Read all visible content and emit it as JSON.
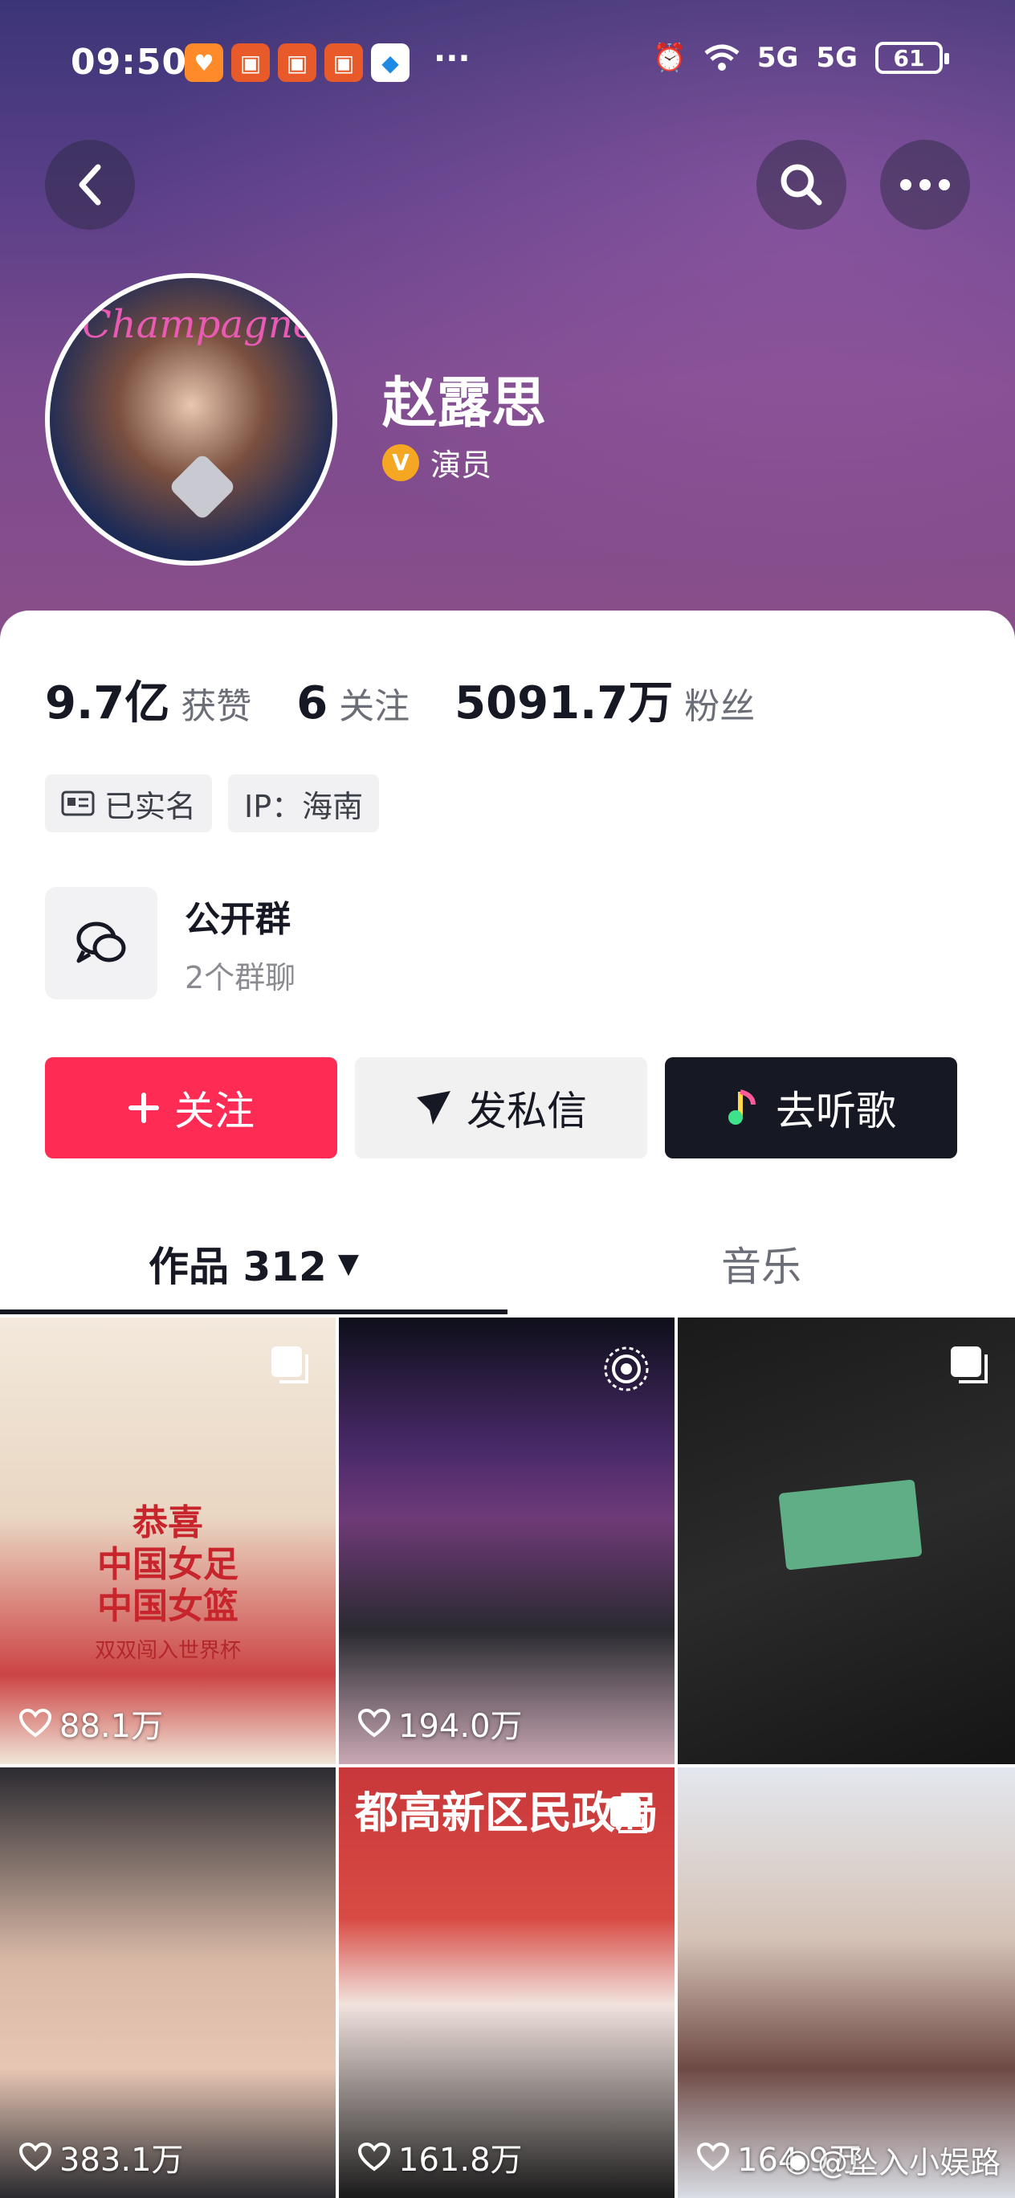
{
  "status_bar": {
    "time": "09:50",
    "more": "···",
    "signal1": "5G",
    "signal2": "5G",
    "battery": "61"
  },
  "profile": {
    "name": "赵露思",
    "verified_label": "演员",
    "avatar_text": "Champagne"
  },
  "stats": [
    {
      "value": "9.7亿",
      "label": "获赞"
    },
    {
      "value": "6",
      "label": "关注"
    },
    {
      "value": "5091.7万",
      "label": "粉丝"
    }
  ],
  "tags": {
    "real_name": "已实名",
    "ip": "IP：海南"
  },
  "group": {
    "title": "公开群",
    "subtitle": "2个群聊"
  },
  "actions": {
    "follow": "关注",
    "message": "发私信",
    "music": "去听歌"
  },
  "tabs": {
    "works": "作品 312",
    "music": "音乐"
  },
  "videos": [
    {
      "likes": "88.1万",
      "poster_line1": "恭喜",
      "poster_line2": "中国女足",
      "poster_line3": "中国女篮",
      "poster_sub": "双双闯入世界杯"
    },
    {
      "likes": "194.0万"
    },
    {
      "likes": ""
    },
    {
      "likes": "383.1万"
    },
    {
      "likes": "161.8万",
      "banner": "都高新区民政局"
    },
    {
      "likes": "164.9万"
    }
  ],
  "watermark": "@坠入小娱路",
  "colors": {
    "follow": "#fe2c55",
    "music_btn": "#161823",
    "verify": "#f5a623"
  }
}
